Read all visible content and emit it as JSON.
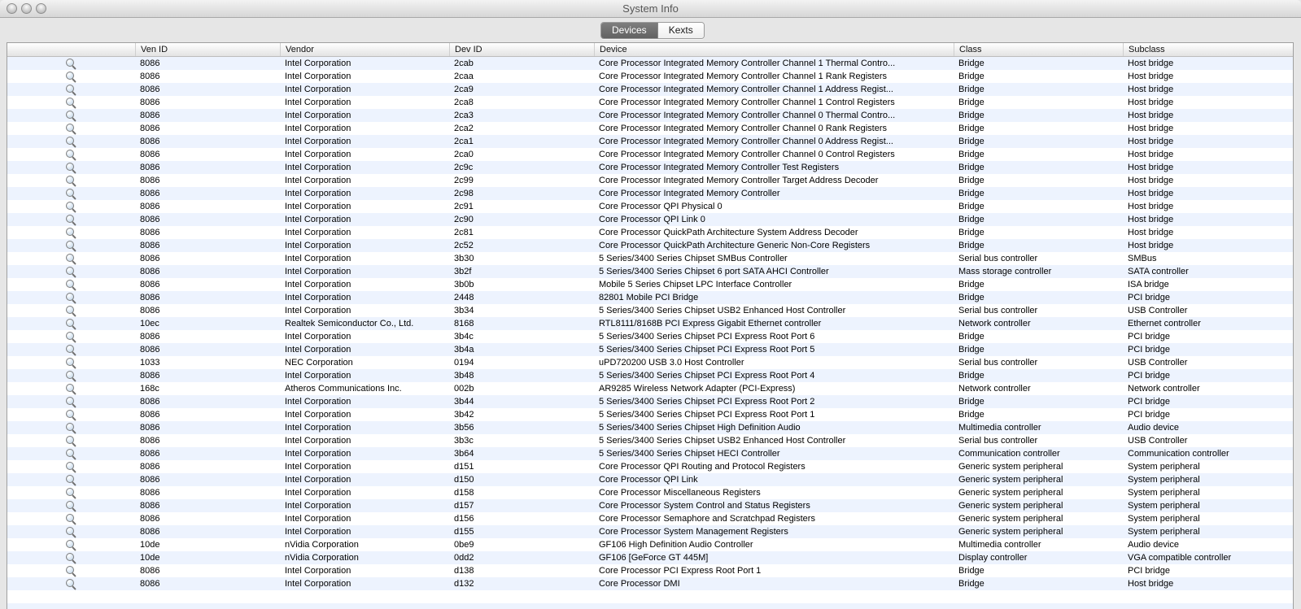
{
  "window": {
    "title": "System Info"
  },
  "tabs": [
    {
      "label": "Devices",
      "selected": true
    },
    {
      "label": "Kexts",
      "selected": false
    }
  ],
  "colors": {
    "row_stripe": "#edf3fe",
    "selected_tab_bg": "#6e6e6e",
    "selected_tab_text": "#ffffff"
  },
  "table": {
    "columns": [
      {
        "key": "icon",
        "label": ""
      },
      {
        "key": "ven_id",
        "label": "Ven ID"
      },
      {
        "key": "vendor",
        "label": "Vendor"
      },
      {
        "key": "dev_id",
        "label": "Dev ID"
      },
      {
        "key": "device",
        "label": "Device"
      },
      {
        "key": "class",
        "label": "Class"
      },
      {
        "key": "subclass",
        "label": "Subclass"
      }
    ],
    "rows": [
      [
        "8086",
        "Intel Corporation",
        "2cab",
        "Core Processor Integrated Memory Controller Channel 1 Thermal Contro...",
        "Bridge",
        "Host bridge"
      ],
      [
        "8086",
        "Intel Corporation",
        "2caa",
        "Core Processor Integrated Memory Controller Channel 1 Rank Registers",
        "Bridge",
        "Host bridge"
      ],
      [
        "8086",
        "Intel Corporation",
        "2ca9",
        "Core Processor Integrated Memory Controller Channel 1 Address Regist...",
        "Bridge",
        "Host bridge"
      ],
      [
        "8086",
        "Intel Corporation",
        "2ca8",
        "Core Processor Integrated Memory Controller Channel 1 Control Registers",
        "Bridge",
        "Host bridge"
      ],
      [
        "8086",
        "Intel Corporation",
        "2ca3",
        "Core Processor Integrated Memory Controller Channel 0 Thermal Contro...",
        "Bridge",
        "Host bridge"
      ],
      [
        "8086",
        "Intel Corporation",
        "2ca2",
        "Core Processor Integrated Memory Controller Channel 0 Rank Registers",
        "Bridge",
        "Host bridge"
      ],
      [
        "8086",
        "Intel Corporation",
        "2ca1",
        "Core Processor Integrated Memory Controller Channel 0 Address Regist...",
        "Bridge",
        "Host bridge"
      ],
      [
        "8086",
        "Intel Corporation",
        "2ca0",
        "Core Processor Integrated Memory Controller Channel 0 Control Registers",
        "Bridge",
        "Host bridge"
      ],
      [
        "8086",
        "Intel Corporation",
        "2c9c",
        "Core Processor Integrated Memory Controller Test Registers",
        "Bridge",
        "Host bridge"
      ],
      [
        "8086",
        "Intel Corporation",
        "2c99",
        "Core Processor Integrated Memory Controller Target Address Decoder",
        "Bridge",
        "Host bridge"
      ],
      [
        "8086",
        "Intel Corporation",
        "2c98",
        "Core Processor Integrated Memory Controller",
        "Bridge",
        "Host bridge"
      ],
      [
        "8086",
        "Intel Corporation",
        "2c91",
        "Core Processor QPI Physical 0",
        "Bridge",
        "Host bridge"
      ],
      [
        "8086",
        "Intel Corporation",
        "2c90",
        "Core Processor QPI Link 0",
        "Bridge",
        "Host bridge"
      ],
      [
        "8086",
        "Intel Corporation",
        "2c81",
        "Core Processor QuickPath Architecture System Address Decoder",
        "Bridge",
        "Host bridge"
      ],
      [
        "8086",
        "Intel Corporation",
        "2c52",
        "Core Processor QuickPath Architecture Generic Non-Core Registers",
        "Bridge",
        "Host bridge"
      ],
      [
        "8086",
        "Intel Corporation",
        "3b30",
        "5 Series/3400 Series Chipset SMBus Controller",
        "Serial bus controller",
        "SMBus"
      ],
      [
        "8086",
        "Intel Corporation",
        "3b2f",
        "5 Series/3400 Series Chipset 6 port SATA AHCI Controller",
        "Mass storage controller",
        "SATA controller"
      ],
      [
        "8086",
        "Intel Corporation",
        "3b0b",
        "Mobile 5 Series Chipset LPC Interface Controller",
        "Bridge",
        "ISA bridge"
      ],
      [
        "8086",
        "Intel Corporation",
        "2448",
        "82801 Mobile PCI Bridge",
        "Bridge",
        "PCI bridge"
      ],
      [
        "8086",
        "Intel Corporation",
        "3b34",
        "5 Series/3400 Series Chipset USB2 Enhanced Host Controller",
        "Serial bus controller",
        "USB Controller"
      ],
      [
        "10ec",
        "Realtek Semiconductor Co., Ltd.",
        "8168",
        "RTL8111/8168B PCI Express Gigabit Ethernet controller",
        "Network controller",
        "Ethernet controller"
      ],
      [
        "8086",
        "Intel Corporation",
        "3b4c",
        "5 Series/3400 Series Chipset PCI Express Root Port 6",
        "Bridge",
        "PCI bridge"
      ],
      [
        "8086",
        "Intel Corporation",
        "3b4a",
        "5 Series/3400 Series Chipset PCI Express Root Port 5",
        "Bridge",
        "PCI bridge"
      ],
      [
        "1033",
        "NEC Corporation",
        "0194",
        "uPD720200 USB 3.0 Host Controller",
        "Serial bus controller",
        "USB Controller"
      ],
      [
        "8086",
        "Intel Corporation",
        "3b48",
        "5 Series/3400 Series Chipset PCI Express Root Port 4",
        "Bridge",
        "PCI bridge"
      ],
      [
        "168c",
        "Atheros Communications Inc.",
        "002b",
        "AR9285 Wireless Network Adapter (PCI-Express)",
        "Network controller",
        "Network controller"
      ],
      [
        "8086",
        "Intel Corporation",
        "3b44",
        "5 Series/3400 Series Chipset PCI Express Root Port 2",
        "Bridge",
        "PCI bridge"
      ],
      [
        "8086",
        "Intel Corporation",
        "3b42",
        "5 Series/3400 Series Chipset PCI Express Root Port 1",
        "Bridge",
        "PCI bridge"
      ],
      [
        "8086",
        "Intel Corporation",
        "3b56",
        "5 Series/3400 Series Chipset High Definition Audio",
        "Multimedia controller",
        "Audio device"
      ],
      [
        "8086",
        "Intel Corporation",
        "3b3c",
        "5 Series/3400 Series Chipset USB2 Enhanced Host Controller",
        "Serial bus controller",
        "USB Controller"
      ],
      [
        "8086",
        "Intel Corporation",
        "3b64",
        "5 Series/3400 Series Chipset HECI Controller",
        "Communication controller",
        "Communication controller"
      ],
      [
        "8086",
        "Intel Corporation",
        "d151",
        "Core Processor QPI Routing and Protocol Registers",
        "Generic system peripheral",
        "System peripheral"
      ],
      [
        "8086",
        "Intel Corporation",
        "d150",
        "Core Processor QPI Link",
        "Generic system peripheral",
        "System peripheral"
      ],
      [
        "8086",
        "Intel Corporation",
        "d158",
        "Core Processor Miscellaneous Registers",
        "Generic system peripheral",
        "System peripheral"
      ],
      [
        "8086",
        "Intel Corporation",
        "d157",
        "Core Processor System Control and Status Registers",
        "Generic system peripheral",
        "System peripheral"
      ],
      [
        "8086",
        "Intel Corporation",
        "d156",
        "Core Processor Semaphore and Scratchpad Registers",
        "Generic system peripheral",
        "System peripheral"
      ],
      [
        "8086",
        "Intel Corporation",
        "d155",
        "Core Processor System Management Registers",
        "Generic system peripheral",
        "System peripheral"
      ],
      [
        "10de",
        "nVidia Corporation",
        "0be9",
        "GF106 High Definition Audio Controller",
        "Multimedia controller",
        "Audio device"
      ],
      [
        "10de",
        "nVidia Corporation",
        "0dd2",
        "GF106 [GeForce GT 445M]",
        "Display controller",
        "VGA compatible controller"
      ],
      [
        "8086",
        "Intel Corporation",
        "d138",
        "Core Processor PCI Express Root Port 1",
        "Bridge",
        "PCI bridge"
      ],
      [
        "8086",
        "Intel Corporation",
        "d132",
        "Core Processor DMI",
        "Bridge",
        "Host bridge"
      ]
    ]
  }
}
